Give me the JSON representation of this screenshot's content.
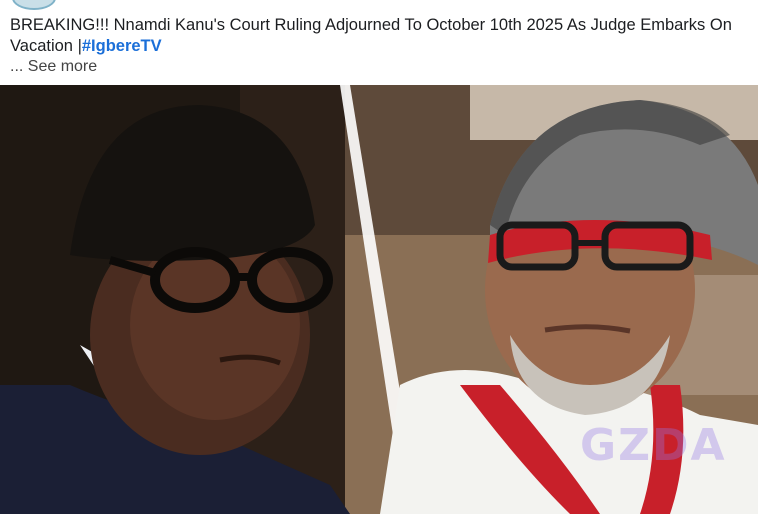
{
  "post": {
    "caption": "BREAKING!!! Nnamdi Kanu's Court Ruling Adjourned To October 10th 2025 As Judge Embarks On Vacation |",
    "hashtag": "#IgbereTV",
    "see_more": "... See more"
  },
  "image": {
    "watermark": "GZDA"
  },
  "colors": {
    "hashtag": "#1b6fd8",
    "cap_red": "#c8202a",
    "robe": "#f3f3f0"
  }
}
